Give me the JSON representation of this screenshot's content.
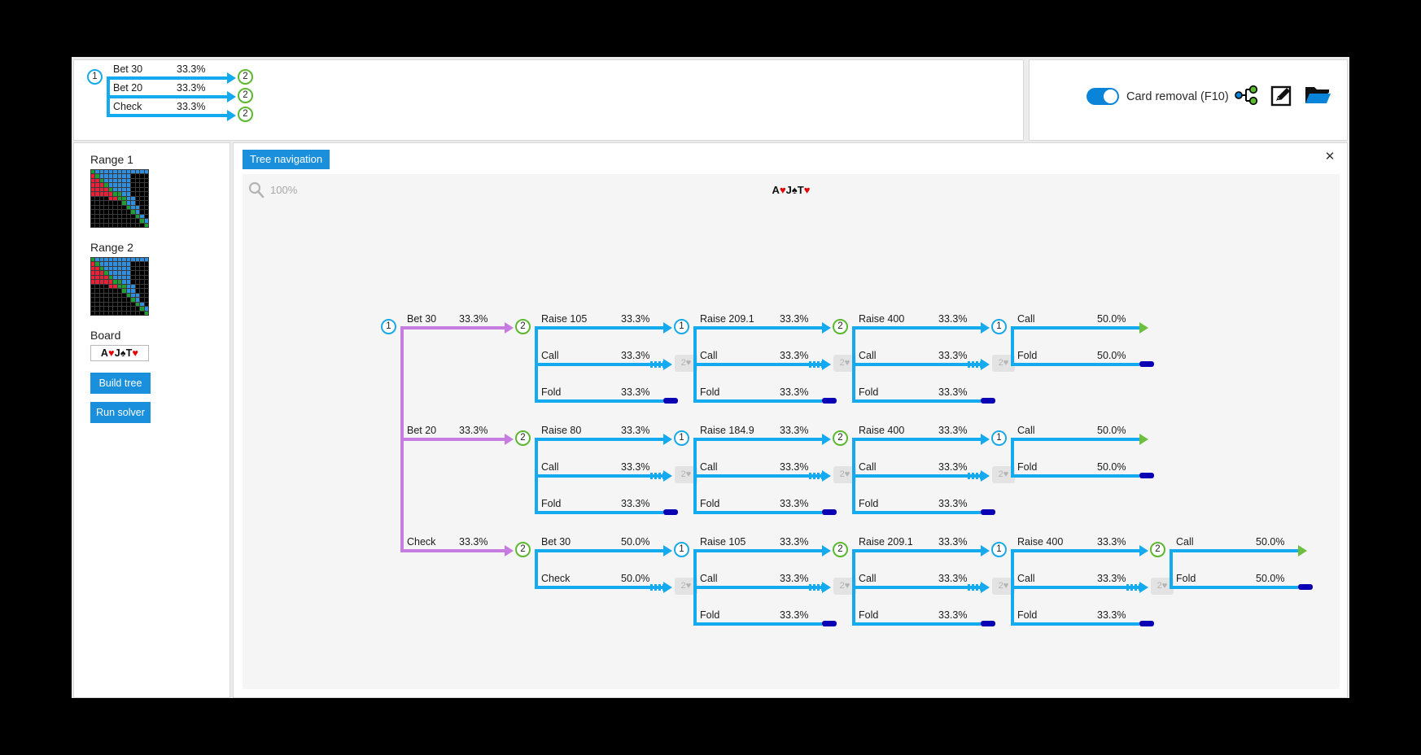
{
  "toolbar": {
    "card_removal_label": "Card removal (F10)",
    "card_removal_on": true,
    "icons": [
      "tree-graph-icon",
      "edit-pencil-icon",
      "open-folder-icon"
    ]
  },
  "mini_tree": {
    "root_player": "1",
    "branches": [
      {
        "label": "Bet 30",
        "pct": "33.3%",
        "player": "2"
      },
      {
        "label": "Bet 20",
        "pct": "33.3%",
        "player": "2"
      },
      {
        "label": "Check",
        "pct": "33.3%",
        "player": "2"
      }
    ]
  },
  "sidebar": {
    "range1_label": "Range 1",
    "range2_label": "Range 2",
    "board_label": "Board",
    "board_value": "A♥J♠T♥",
    "build_tree_label": "Build tree",
    "run_solver_label": "Run solver"
  },
  "content": {
    "tab_label": "Tree navigation",
    "close_label": "✕",
    "zoom_label": "100%",
    "board_cards": "A♥J♠T♥"
  },
  "tree": {
    "rows": [
      {
        "root_label": "Bet 30",
        "root_pct": "33.3%",
        "root_node": "2",
        "cols": [
          {
            "node": "2",
            "next_node": "1",
            "actions": [
              {
                "label": "Raise 105",
                "pct": "33.3%",
                "term": "node"
              },
              {
                "label": "Call",
                "pct": "33.3%",
                "term": "card"
              },
              {
                "label": "Fold",
                "pct": "33.3%",
                "term": "bar"
              }
            ]
          },
          {
            "node": "1",
            "next_node": "2",
            "actions": [
              {
                "label": "Raise 209.1",
                "pct": "33.3%",
                "term": "node"
              },
              {
                "label": "Call",
                "pct": "33.3%",
                "term": "card"
              },
              {
                "label": "Fold",
                "pct": "33.3%",
                "term": "bar"
              }
            ]
          },
          {
            "node": "2",
            "next_node": "1",
            "actions": [
              {
                "label": "Raise 400",
                "pct": "33.3%",
                "term": "node"
              },
              {
                "label": "Call",
                "pct": "33.3%",
                "term": "card"
              },
              {
                "label": "Fold",
                "pct": "33.3%",
                "term": "bar"
              }
            ]
          },
          {
            "node": "1",
            "next_node": null,
            "actions": [
              {
                "label": "Call",
                "pct": "50.0%",
                "term": "green"
              },
              {
                "label": "Fold",
                "pct": "50.0%",
                "term": "bar"
              }
            ]
          }
        ]
      },
      {
        "root_label": "Bet 20",
        "root_pct": "33.3%",
        "root_node": "2",
        "cols": [
          {
            "node": "2",
            "next_node": "1",
            "actions": [
              {
                "label": "Raise 80",
                "pct": "33.3%",
                "term": "node"
              },
              {
                "label": "Call",
                "pct": "33.3%",
                "term": "card"
              },
              {
                "label": "Fold",
                "pct": "33.3%",
                "term": "bar"
              }
            ]
          },
          {
            "node": "1",
            "next_node": "2",
            "actions": [
              {
                "label": "Raise 184.9",
                "pct": "33.3%",
                "term": "node"
              },
              {
                "label": "Call",
                "pct": "33.3%",
                "term": "card"
              },
              {
                "label": "Fold",
                "pct": "33.3%",
                "term": "bar"
              }
            ]
          },
          {
            "node": "2",
            "next_node": "1",
            "actions": [
              {
                "label": "Raise 400",
                "pct": "33.3%",
                "term": "node"
              },
              {
                "label": "Call",
                "pct": "33.3%",
                "term": "card"
              },
              {
                "label": "Fold",
                "pct": "33.3%",
                "term": "bar"
              }
            ]
          },
          {
            "node": "1",
            "next_node": null,
            "actions": [
              {
                "label": "Call",
                "pct": "50.0%",
                "term": "green"
              },
              {
                "label": "Fold",
                "pct": "50.0%",
                "term": "bar"
              }
            ]
          }
        ]
      },
      {
        "root_label": "Check",
        "root_pct": "33.3%",
        "root_node": "2",
        "cols": [
          {
            "node": "2",
            "next_node": "1",
            "actions": [
              {
                "label": "Bet 30",
                "pct": "50.0%",
                "term": "node"
              },
              {
                "label": "Check",
                "pct": "50.0%",
                "term": "card"
              }
            ]
          },
          {
            "node": "1",
            "next_node": "2",
            "actions": [
              {
                "label": "Raise 105",
                "pct": "33.3%",
                "term": "node"
              },
              {
                "label": "Call",
                "pct": "33.3%",
                "term": "card"
              },
              {
                "label": "Fold",
                "pct": "33.3%",
                "term": "bar"
              }
            ]
          },
          {
            "node": "2",
            "next_node": "1",
            "actions": [
              {
                "label": "Raise 209.1",
                "pct": "33.3%",
                "term": "node"
              },
              {
                "label": "Call",
                "pct": "33.3%",
                "term": "card"
              },
              {
                "label": "Fold",
                "pct": "33.3%",
                "term": "bar"
              }
            ]
          },
          {
            "node": "1",
            "next_node": "2",
            "actions": [
              {
                "label": "Raise 400",
                "pct": "33.3%",
                "term": "node"
              },
              {
                "label": "Call",
                "pct": "33.3%",
                "term": "card"
              },
              {
                "label": "Fold",
                "pct": "33.3%",
                "term": "bar"
              }
            ]
          },
          {
            "node": "2",
            "next_node": null,
            "actions": [
              {
                "label": "Call",
                "pct": "50.0%",
                "term": "green"
              },
              {
                "label": "Fold",
                "pct": "50.0%",
                "term": "bar"
              }
            ]
          }
        ]
      }
    ],
    "card_chip_label": "2♥"
  },
  "colors": {
    "accent": "#1a8fdc",
    "edge_blue": "#14aaf0",
    "edge_purple": "#c77de0",
    "node_p1": "#1aa9e8",
    "node_p2": "#5cb82e",
    "terminal_green": "#6cbf3f",
    "terminal_fold": "#0a00b4"
  },
  "range_grids": {
    "range1": "GBBBBBBBBBBBB RGBBBBBBBKKKK RRGBBBBBBKKKK RRRGBBBBBKKKK RRRRGBBBBKKKK RRRRRGGBBKKKK KKKKRRGGBBKKK KKKKKKKGBBKKK KKKKKKKKGBBKK KKKKKKKKKGBKK KKKKKKKKKKGBK KKKKKKKKKKKGB KKKKKKKKKKKKG",
    "range2": "GBBBBBBBBBBBB RGBBBBBBBKKKK RRGBBBBBBKKKK RRRGBBBBBKKKK RRRRGBBBBKKKK RRRRRGGBBKKKK KKKKRRGGBBKKK KKKKKKKGBBKKK KKKKKKKKGBBKK KKKKKKKKKGBKK KKKKKKKKKKGBK KKKKKKKKKKKGB KKKKKKKKKKKKG"
  }
}
